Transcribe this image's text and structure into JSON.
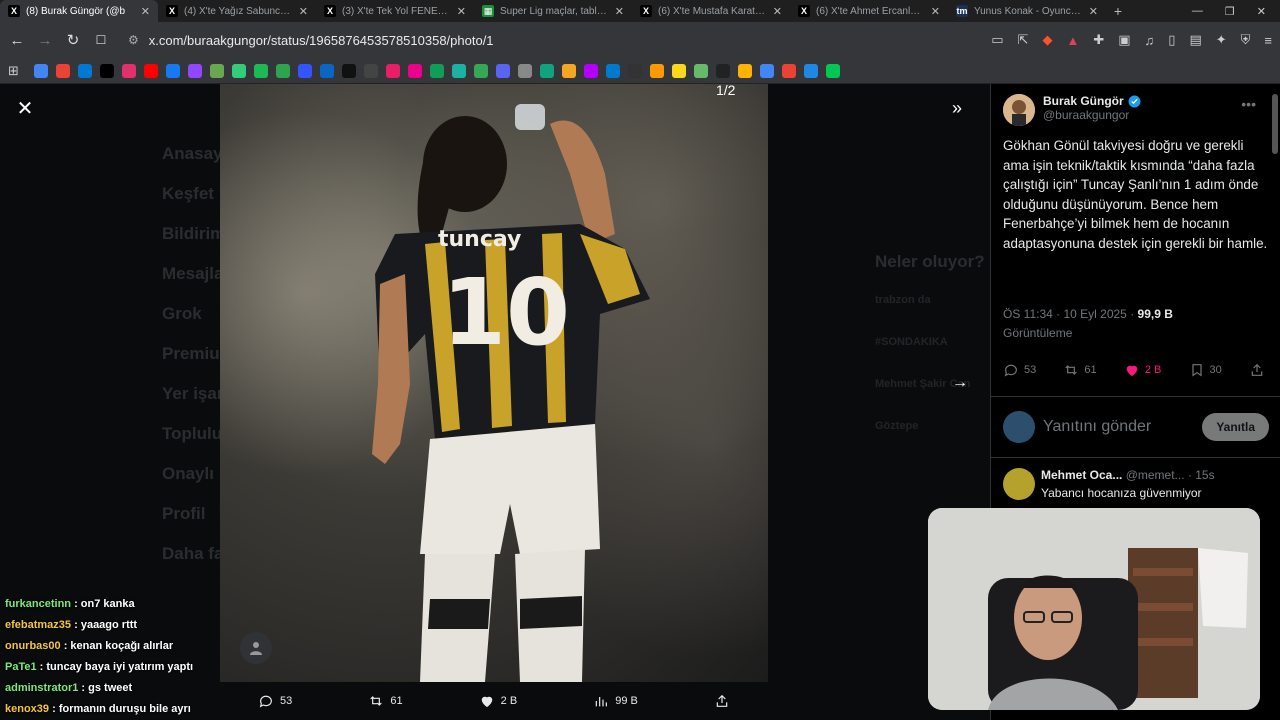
{
  "tabs": [
    {
      "title": "(8) Burak Güngör (@b",
      "active": true,
      "icon": "x-icon",
      "color": "#000000"
    },
    {
      "title": "(4) X'te Yağız Sabuncuoğl",
      "active": false,
      "icon": "x-icon",
      "color": "#000000"
    },
    {
      "title": "(3) X'te Tek Yol FENER: \"*",
      "active": false,
      "icon": "x-icon",
      "color": "#000000"
    },
    {
      "title": "Super Lig maçlar, tablolar",
      "active": false,
      "icon": "sheets-icon",
      "color": "#1e8e3e"
    },
    {
      "title": "(6) X'te Mustafa Karataş: \"",
      "active": false,
      "icon": "x-icon",
      "color": "#000000"
    },
    {
      "title": "(6) X'te Ahmet Ercanlar: \"",
      "active": false,
      "icon": "x-icon",
      "color": "#000000"
    },
    {
      "title": "Yunus Konak - Oyuncu p",
      "active": false,
      "icon": "tm-icon",
      "color": "#1a3151"
    }
  ],
  "address": {
    "url": "x.com/buraakgungor/status/1965876453578510358/photo/1"
  },
  "viewer": {
    "counter": "1/2",
    "photo_jersey_name": "tuncay",
    "photo_jersey_number": "10"
  },
  "photo_actions": {
    "replies": "53",
    "reposts": "61",
    "likes": "2 B",
    "views": "99 B"
  },
  "background_nav": [
    "Anasayfa",
    "Keşfet",
    "Bildirim",
    "Mesajlar",
    "Grok",
    "Premium",
    "Yer işaret",
    "Topluluk",
    "Onaylı",
    "Profil",
    "Daha fa"
  ],
  "background_trends": [
    "Neler oluyor?",
    "trabzon da",
    "#SONDAKIKA",
    "Mehmet Şakir Can",
    "Göztepe"
  ],
  "chat": [
    {
      "user": "furkancetinn",
      "color": "#7ee87e",
      "text": "on7 kanka"
    },
    {
      "user": "efebatmaz35",
      "color": "#f4c542",
      "text": "yaaago rttt"
    },
    {
      "user": "onurbas00",
      "color": "#f4c542",
      "text": "kenan koçağı alırlar"
    },
    {
      "user": "PaTe1",
      "color": "#7ee87e",
      "text": "tuncay baya iyi yatırım yaptı"
    },
    {
      "user": "adminstrator1",
      "color": "#7ee87e",
      "text": "gs tweet"
    },
    {
      "user": "kenox39",
      "color": "#f4c542",
      "text": "formanın duruşu bile ayrı"
    }
  ],
  "tweet": {
    "author": "Burak Güngör",
    "handle": "@buraakgungor",
    "text": "Gökhan Gönül takviyesi doğru ve gerekli ama işin teknik/taktik kısmında “daha fazla çalıştığı için” Tuncay Şanlı’nın 1 adım önde olduğunu düşünüyorum. Bence hem Fenerbahçe’yi bilmek hem de hocanın adaptasyonuna destek için gerekli bir hamle.",
    "time": "ÖS 11:34 · 10 Eyl 2025 · ",
    "views": "99,9 B",
    "views_label": "Görüntüleme",
    "replies": "53",
    "reposts": "61",
    "likes": "2 B",
    "bookmarks": "30"
  },
  "reply_box": {
    "placeholder": "Yanıtını gönder",
    "button": "Yanıtla"
  },
  "first_reply": {
    "author": "Mehmet Oca...",
    "handle": "@memet...",
    "time": "· 15s",
    "text": "Yabancı hocanıza güvenmiyor"
  },
  "colors": {
    "like": "#f91880",
    "verified": "#1d9bf0",
    "muted": "#71767b",
    "text": "#e7e9ea"
  }
}
